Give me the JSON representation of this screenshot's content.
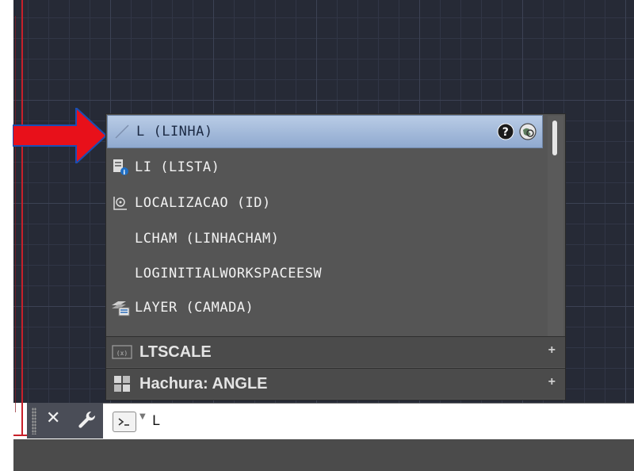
{
  "autocomplete": {
    "items": [
      {
        "label": "L (LINHA)",
        "icon": "line-icon",
        "selected": true
      },
      {
        "label": "LI (LISTA)",
        "icon": "list-info-icon"
      },
      {
        "label": "LOCALIZACAO (ID)",
        "icon": "locate-point-icon"
      },
      {
        "label": "LCHAM (LINHACHAM)",
        "icon": ""
      },
      {
        "label": "LOGINITIALWORKSPACEESW",
        "icon": ""
      },
      {
        "label": "LAYER (CAMADA)",
        "icon": "layer-icon"
      }
    ],
    "sections": [
      {
        "label": "LTSCALE",
        "icon": "system-variable-icon",
        "expand": "+"
      },
      {
        "label": "Hachura: ANGLE",
        "icon": "hatch-icon",
        "expand": "+"
      }
    ]
  },
  "command_line": {
    "close_icon": "close-icon",
    "customize_icon": "wrench-icon",
    "prompt_icon": "command-prompt-icon",
    "value": "L"
  },
  "colors": {
    "canvas": "#262a36",
    "popup": "#555555",
    "selection": "#a9bfdf",
    "arrow": "#e8101a",
    "ucs": "#c8202a"
  }
}
